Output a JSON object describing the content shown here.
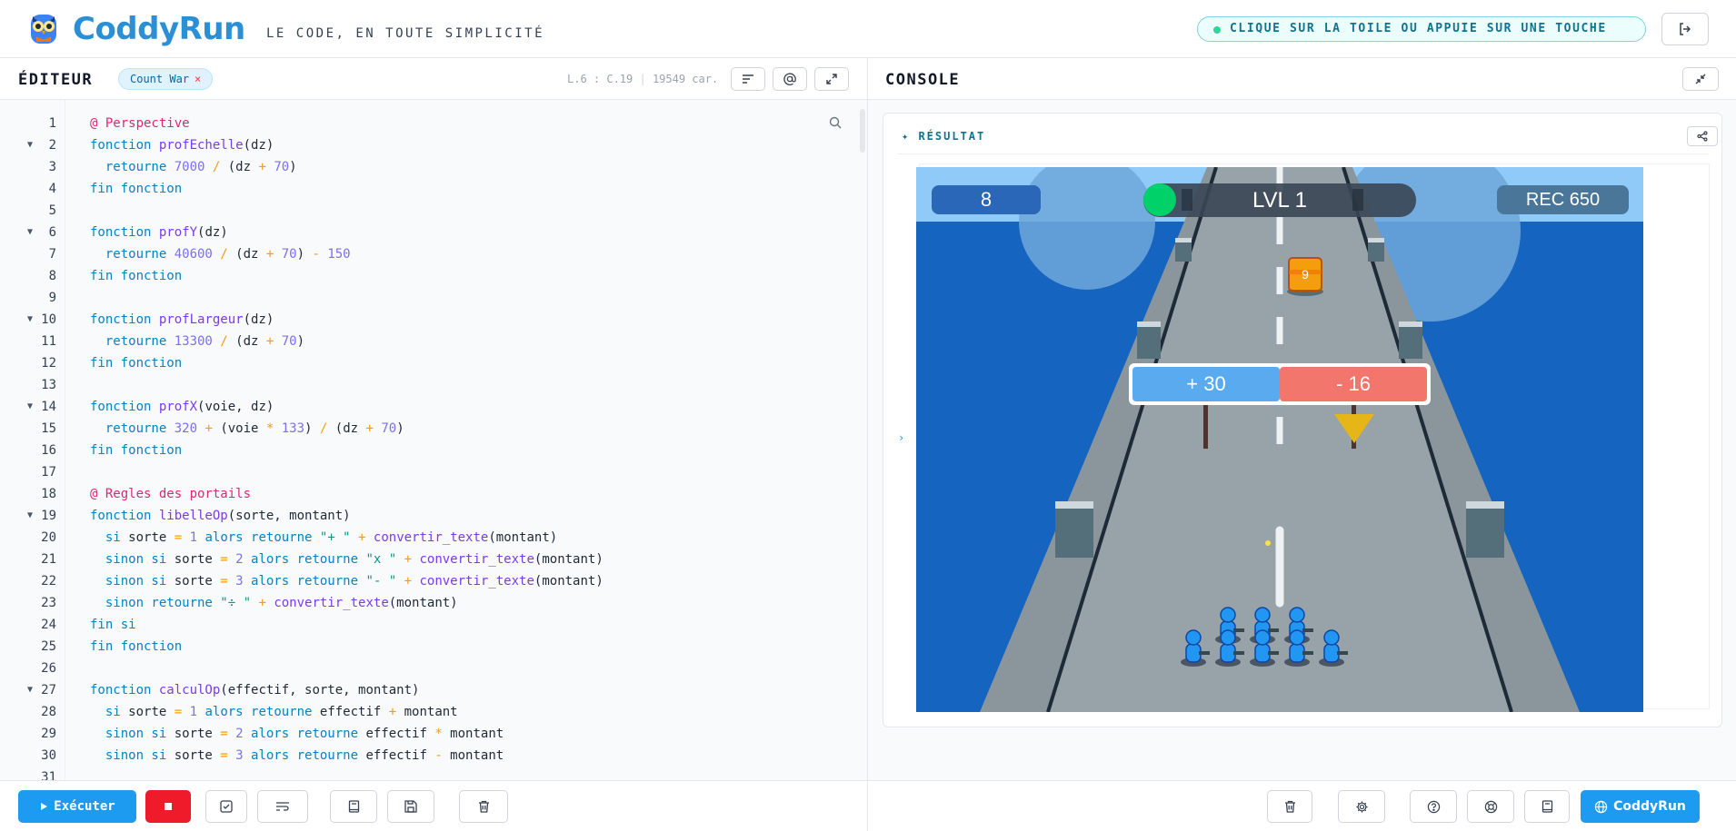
{
  "app": {
    "brand": "CoddyRun",
    "tagline": "LE CODE, EN TOUTE SIMPLICITÉ",
    "hint": "CLIQUE SUR LA TOILE OU APPUIE SUR UNE TOUCHE"
  },
  "editor": {
    "title": "ÉDITEUR",
    "file_tag": "Count War",
    "cursor": "L.6 : C.19",
    "char_count": "19549 car.",
    "lines": [
      {
        "n": "1",
        "fold": false
      },
      {
        "n": "2",
        "fold": true
      },
      {
        "n": "3",
        "fold": false
      },
      {
        "n": "4",
        "fold": false
      },
      {
        "n": "5",
        "fold": false
      },
      {
        "n": "6",
        "fold": true
      },
      {
        "n": "7",
        "fold": false
      },
      {
        "n": "8",
        "fold": false
      },
      {
        "n": "9",
        "fold": false
      },
      {
        "n": "10",
        "fold": true
      },
      {
        "n": "11",
        "fold": false
      },
      {
        "n": "12",
        "fold": false
      },
      {
        "n": "13",
        "fold": false
      },
      {
        "n": "14",
        "fold": true
      },
      {
        "n": "15",
        "fold": false
      },
      {
        "n": "16",
        "fold": false
      },
      {
        "n": "17",
        "fold": false
      },
      {
        "n": "18",
        "fold": false
      },
      {
        "n": "19",
        "fold": true
      },
      {
        "n": "20",
        "fold": false
      },
      {
        "n": "21",
        "fold": false
      },
      {
        "n": "22",
        "fold": false
      },
      {
        "n": "23",
        "fold": false
      },
      {
        "n": "24",
        "fold": false
      },
      {
        "n": "25",
        "fold": false
      },
      {
        "n": "26",
        "fold": false
      },
      {
        "n": "27",
        "fold": true
      },
      {
        "n": "28",
        "fold": false
      },
      {
        "n": "29",
        "fold": false
      },
      {
        "n": "30",
        "fold": false
      },
      {
        "n": "31",
        "fold": false
      }
    ],
    "code": [
      [
        [
          "cm",
          "@ Perspective"
        ]
      ],
      [
        [
          "kw",
          "fonction "
        ],
        [
          "fn",
          "profEchelle"
        ],
        [
          "",
          "(dz)"
        ]
      ],
      [
        [
          "",
          "  "
        ],
        [
          "kw",
          "retourne "
        ],
        [
          "num",
          "7000"
        ],
        [
          "op",
          " / "
        ],
        [
          "",
          "(dz "
        ],
        [
          "op",
          "+ "
        ],
        [
          "num",
          "70"
        ],
        [
          "",
          ")"
        ]
      ],
      [
        [
          "kw",
          "fin fonction"
        ]
      ],
      [],
      [
        [
          "kw",
          "fonction "
        ],
        [
          "fn",
          "profY"
        ],
        [
          "",
          "(dz)"
        ]
      ],
      [
        [
          "",
          "  "
        ],
        [
          "kw",
          "retourne "
        ],
        [
          "num",
          "40600"
        ],
        [
          "op",
          " / "
        ],
        [
          "",
          "(dz "
        ],
        [
          "op",
          "+ "
        ],
        [
          "num",
          "70"
        ],
        [
          "",
          ") "
        ],
        [
          "op",
          "- "
        ],
        [
          "num",
          "150"
        ]
      ],
      [
        [
          "kw",
          "fin fonction"
        ]
      ],
      [],
      [
        [
          "kw",
          "fonction "
        ],
        [
          "fn",
          "profLargeur"
        ],
        [
          "",
          "(dz)"
        ]
      ],
      [
        [
          "",
          "  "
        ],
        [
          "kw",
          "retourne "
        ],
        [
          "num",
          "13300"
        ],
        [
          "op",
          " / "
        ],
        [
          "",
          "(dz "
        ],
        [
          "op",
          "+ "
        ],
        [
          "num",
          "70"
        ],
        [
          "",
          ")"
        ]
      ],
      [
        [
          "kw",
          "fin fonction"
        ]
      ],
      [],
      [
        [
          "kw",
          "fonction "
        ],
        [
          "fn",
          "profX"
        ],
        [
          "",
          "(voie, dz)"
        ]
      ],
      [
        [
          "",
          "  "
        ],
        [
          "kw",
          "retourne "
        ],
        [
          "num",
          "320"
        ],
        [
          "op",
          " + "
        ],
        [
          "",
          "(voie "
        ],
        [
          "op",
          "* "
        ],
        [
          "num",
          "133"
        ],
        [
          "",
          ") "
        ],
        [
          "op",
          "/ "
        ],
        [
          "",
          "(dz "
        ],
        [
          "op",
          "+ "
        ],
        [
          "num",
          "70"
        ],
        [
          "",
          ")"
        ]
      ],
      [
        [
          "kw",
          "fin fonction"
        ]
      ],
      [],
      [
        [
          "cm",
          "@ Regles des portails"
        ]
      ],
      [
        [
          "kw",
          "fonction "
        ],
        [
          "fn",
          "libelleOp"
        ],
        [
          "",
          "(sorte, montant)"
        ]
      ],
      [
        [
          "",
          "  "
        ],
        [
          "kw",
          "si "
        ],
        [
          "",
          "sorte "
        ],
        [
          "op",
          "= "
        ],
        [
          "num",
          "1"
        ],
        [
          "kw",
          " alors retourne "
        ],
        [
          "str",
          "\"+ \""
        ],
        [
          "op",
          " + "
        ],
        [
          "fn",
          "convertir_texte"
        ],
        [
          "",
          "(montant)"
        ]
      ],
      [
        [
          "",
          "  "
        ],
        [
          "kw",
          "sinon si "
        ],
        [
          "",
          "sorte "
        ],
        [
          "op",
          "= "
        ],
        [
          "num",
          "2"
        ],
        [
          "kw",
          " alors retourne "
        ],
        [
          "str",
          "\"x \""
        ],
        [
          "op",
          " + "
        ],
        [
          "fn",
          "convertir_texte"
        ],
        [
          "",
          "(montant)"
        ]
      ],
      [
        [
          "",
          "  "
        ],
        [
          "kw",
          "sinon si "
        ],
        [
          "",
          "sorte "
        ],
        [
          "op",
          "= "
        ],
        [
          "num",
          "3"
        ],
        [
          "kw",
          " alors retourne "
        ],
        [
          "str",
          "\"- \""
        ],
        [
          "op",
          " + "
        ],
        [
          "fn",
          "convertir_texte"
        ],
        [
          "",
          "(montant)"
        ]
      ],
      [
        [
          "",
          "  "
        ],
        [
          "kw",
          "sinon retourne "
        ],
        [
          "str",
          "\"÷ \""
        ],
        [
          "op",
          " + "
        ],
        [
          "fn",
          "convertir_texte"
        ],
        [
          "",
          "(montant)"
        ]
      ],
      [
        [
          "kw",
          "fin si"
        ]
      ],
      [
        [
          "kw",
          "fin fonction"
        ]
      ],
      [],
      [
        [
          "kw",
          "fonction "
        ],
        [
          "fn",
          "calculOp"
        ],
        [
          "",
          "(effectif, sorte, montant)"
        ]
      ],
      [
        [
          "",
          "  "
        ],
        [
          "kw",
          "si "
        ],
        [
          "",
          "sorte "
        ],
        [
          "op",
          "= "
        ],
        [
          "num",
          "1"
        ],
        [
          "kw",
          " alors retourne "
        ],
        [
          "",
          "effectif "
        ],
        [
          "op",
          "+ "
        ],
        [
          "",
          "montant"
        ]
      ],
      [
        [
          "",
          "  "
        ],
        [
          "kw",
          "sinon si "
        ],
        [
          "",
          "sorte "
        ],
        [
          "op",
          "= "
        ],
        [
          "num",
          "2"
        ],
        [
          "kw",
          " alors retourne "
        ],
        [
          "",
          "effectif "
        ],
        [
          "op",
          "* "
        ],
        [
          "",
          "montant"
        ]
      ],
      [
        [
          "",
          "  "
        ],
        [
          "kw",
          "sinon si "
        ],
        [
          "",
          "sorte "
        ],
        [
          "op",
          "= "
        ],
        [
          "num",
          "3"
        ],
        [
          "kw",
          " alors retourne "
        ],
        [
          "",
          "effectif "
        ],
        [
          "op",
          "- "
        ],
        [
          "",
          "montant"
        ]
      ],
      []
    ],
    "run_label": "Exécuter"
  },
  "console": {
    "title": "CONSOLE",
    "result_label": "RÉSULTAT",
    "side_arrow": "›",
    "game": {
      "score": "8",
      "level": "LVL 1",
      "record": "REC 650",
      "gate_left": "+ 30",
      "gate_right": "- 16",
      "block_value": "9"
    },
    "brand_button": "CoddyRun"
  },
  "colors": {
    "accent": "#1d9bf0",
    "brand": "#2b8fd6",
    "stop": "#ef1b2b",
    "gate_plus": "#5aaaf0",
    "gate_minus": "#f2766b",
    "sea": "#1565c0",
    "road": "#97a3a8"
  },
  "icons": {
    "logo": "owl-icon",
    "logout": "logout-icon",
    "format": "align-lines-icon",
    "at": "at-sign-icon",
    "expand": "expand-icon",
    "search": "search-icon",
    "share": "share-icon",
    "check": "check-square-icon",
    "wrap": "wrap-text-icon",
    "book": "book-icon",
    "save": "save-icon",
    "trash": "trash-icon",
    "settings": "gear-icon",
    "help": "help-circle-icon",
    "support": "lifebuoy-icon",
    "globe": "globe-icon"
  }
}
